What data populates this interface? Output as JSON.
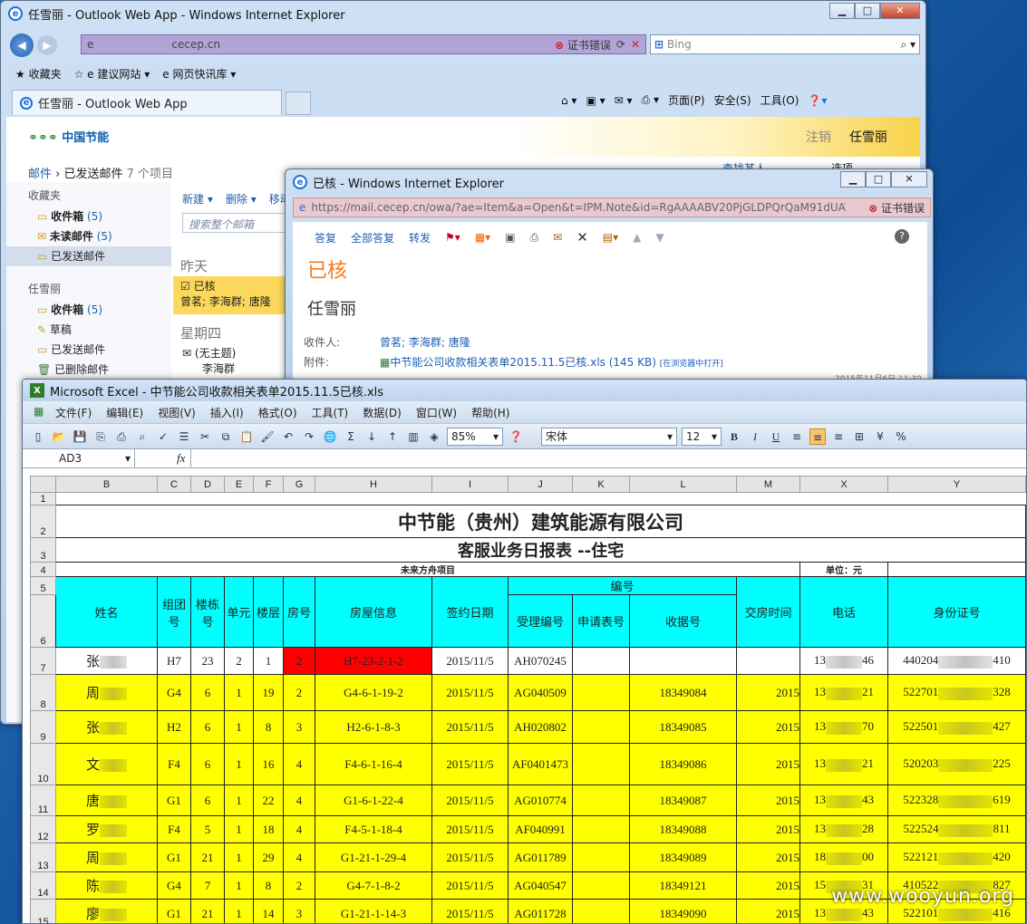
{
  "owa": {
    "title": "任雪丽 - Outlook Web App - Windows Internet Explorer",
    "url": "cecep.cn",
    "cert": "证书错误",
    "bing": "Bing",
    "fav": "收藏夹",
    "fav1": "建议网站",
    "fav2": "网页快讯库",
    "tab": "任雪丽 - Outlook Web App",
    "cmds": [
      "页面(P)",
      "安全(S)",
      "工具(O)"
    ],
    "logo": "中国节能",
    "logout": "注销",
    "user": "任雪丽",
    "crumb_mail": "邮件",
    "crumb_folder": "已发送邮件",
    "crumb_count": "7 个项目",
    "findsomeone": "查找某人",
    "options": "选项",
    "fav_header": "收藏夹",
    "fav_items": [
      {
        "label": "收件箱",
        "count": "(5)"
      },
      {
        "label": "未读邮件",
        "count": "(5)"
      },
      {
        "label": "已发送邮件",
        "count": ""
      }
    ],
    "user_header": "任雪丽",
    "user_items": [
      {
        "label": "收件箱",
        "count": "(5)"
      },
      {
        "label": "草稿",
        "count": ""
      },
      {
        "label": "已发送邮件",
        "count": ""
      },
      {
        "label": "已删除邮件",
        "count": ""
      }
    ],
    "toolbar": [
      "新建",
      "删除",
      "移动"
    ],
    "search": "搜索整个邮箱",
    "group1": "昨天",
    "msg1_subj": "已核",
    "msg1_to": "曾茗; 李海群; 唐隆",
    "group2": "星期四",
    "msg2_subj": "(无主题)",
    "msg2_to": "李海群"
  },
  "msg": {
    "title": "已核 - Windows Internet Explorer",
    "url": "https://mail.cecep.cn/owa/?ae=Item&a=Open&t=IPM.Note&id=RgAAAABV20PjGLDPQrQaM91dUAYEI",
    "cert": "证书错误",
    "reply": "答复",
    "replyall": "全部答复",
    "forward": "转发",
    "subject": "已核",
    "sender": "任雪丽",
    "to_label": "收件人:",
    "to": "曾茗; 李海群; 唐隆",
    "att_label": "附件:",
    "att": "中节能公司收款相关表单2015.11.5已核.xls (145 KB)",
    "att_open": "[在浏览器中打开]",
    "date": "2015年11月6日 11:30"
  },
  "excel": {
    "title": "Microsoft Excel - 中节能公司收款相关表单2015.11.5已核.xls",
    "menus": [
      "文件(F)",
      "编辑(E)",
      "视图(V)",
      "插入(I)",
      "格式(O)",
      "工具(T)",
      "数据(D)",
      "窗口(W)",
      "帮助(H)"
    ],
    "zoom": "85%",
    "font": "宋体",
    "size": "12",
    "cellref": "AD3",
    "fx": "fx",
    "cols": [
      "B",
      "C",
      "D",
      "E",
      "F",
      "G",
      "H",
      "I",
      "J",
      "K",
      "L",
      "M",
      "X",
      "Y"
    ],
    "company": "中节能（贵州）建筑能源有限公司",
    "report": "客服业务日报表 --住宅",
    "proj": "未来方舟项目",
    "unit": "单位：元",
    "h_code": "编号",
    "headers": [
      "姓名",
      "组团号",
      "楼栋号",
      "单元",
      "楼层",
      "房号",
      "房屋信息",
      "签约日期",
      "受理编号",
      "申请表号",
      "收据号",
      "交房时间",
      "电话",
      "身份证号"
    ],
    "rows": [
      {
        "r": "7",
        "name": "张",
        "c": "H7",
        "d": "23",
        "e": "2",
        "f": "1",
        "g": "2",
        "h": "H7-23-2-1-2",
        "i": "2015/11/5",
        "j": "AH070245",
        "l": "",
        "m": "",
        "x1": "13",
        "x2": "46",
        "y1": "440204",
        "y2": "410"
      },
      {
        "r": "8",
        "name": "周",
        "c": "G4",
        "d": "6",
        "e": "1",
        "f": "19",
        "g": "2",
        "h": "G4-6-1-19-2",
        "i": "2015/11/5",
        "j": "AG040509",
        "l": "18349084",
        "m": "2015",
        "x1": "13",
        "x2": "21",
        "y1": "522701",
        "y2": "328"
      },
      {
        "r": "9",
        "name": "张",
        "c": "H2",
        "d": "6",
        "e": "1",
        "f": "8",
        "g": "3",
        "h": "H2-6-1-8-3",
        "i": "2015/11/5",
        "j": "AH020802",
        "l": "18349085",
        "m": "2015",
        "x1": "13",
        "x2": "70",
        "y1": "522501",
        "y2": "427"
      },
      {
        "r": "10",
        "name": "文",
        "c": "F4",
        "d": "6",
        "e": "1",
        "f": "16",
        "g": "4",
        "h": "F4-6-1-16-4",
        "i": "2015/11/5",
        "j": "AF0401473",
        "l": "18349086",
        "m": "2015",
        "x1": "13",
        "x2": "21",
        "y1": "520203",
        "y2": "225"
      },
      {
        "r": "11",
        "name": "唐",
        "c": "G1",
        "d": "6",
        "e": "1",
        "f": "22",
        "g": "4",
        "h": "G1-6-1-22-4",
        "i": "2015/11/5",
        "j": "AG010774",
        "l": "18349087",
        "m": "2015",
        "x1": "13",
        "x2": "43",
        "y1": "522328",
        "y2": "619"
      },
      {
        "r": "12",
        "name": "罗",
        "c": "F4",
        "d": "5",
        "e": "1",
        "f": "18",
        "g": "4",
        "h": "F4-5-1-18-4",
        "i": "2015/11/5",
        "j": "AF040991",
        "l": "18349088",
        "m": "2015",
        "x1": "13",
        "x2": "28",
        "y1": "522524",
        "y2": "811"
      },
      {
        "r": "13",
        "name": "周",
        "c": "G1",
        "d": "21",
        "e": "1",
        "f": "29",
        "g": "4",
        "h": "G1-21-1-29-4",
        "i": "2015/11/5",
        "j": "AG011789",
        "l": "18349089",
        "m": "2015",
        "x1": "18",
        "x2": "00",
        "y1": "522121",
        "y2": "420"
      },
      {
        "r": "14",
        "name": "陈",
        "c": "G4",
        "d": "7",
        "e": "1",
        "f": "8",
        "g": "2",
        "h": "G4-7-1-8-2",
        "i": "2015/11/5",
        "j": "AG040547",
        "l": "18349121",
        "m": "2015",
        "x1": "15",
        "x2": "31",
        "y1": "410522",
        "y2": "827"
      },
      {
        "r": "15",
        "name": "廖",
        "c": "G1",
        "d": "21",
        "e": "1",
        "f": "14",
        "g": "3",
        "h": "G1-21-1-14-3",
        "i": "2015/11/5",
        "j": "AG011728",
        "l": "18349090",
        "m": "2015",
        "x1": "13",
        "x2": "43",
        "y1": "522101",
        "y2": "416"
      }
    ]
  },
  "watermark": "www.wooyun.org"
}
